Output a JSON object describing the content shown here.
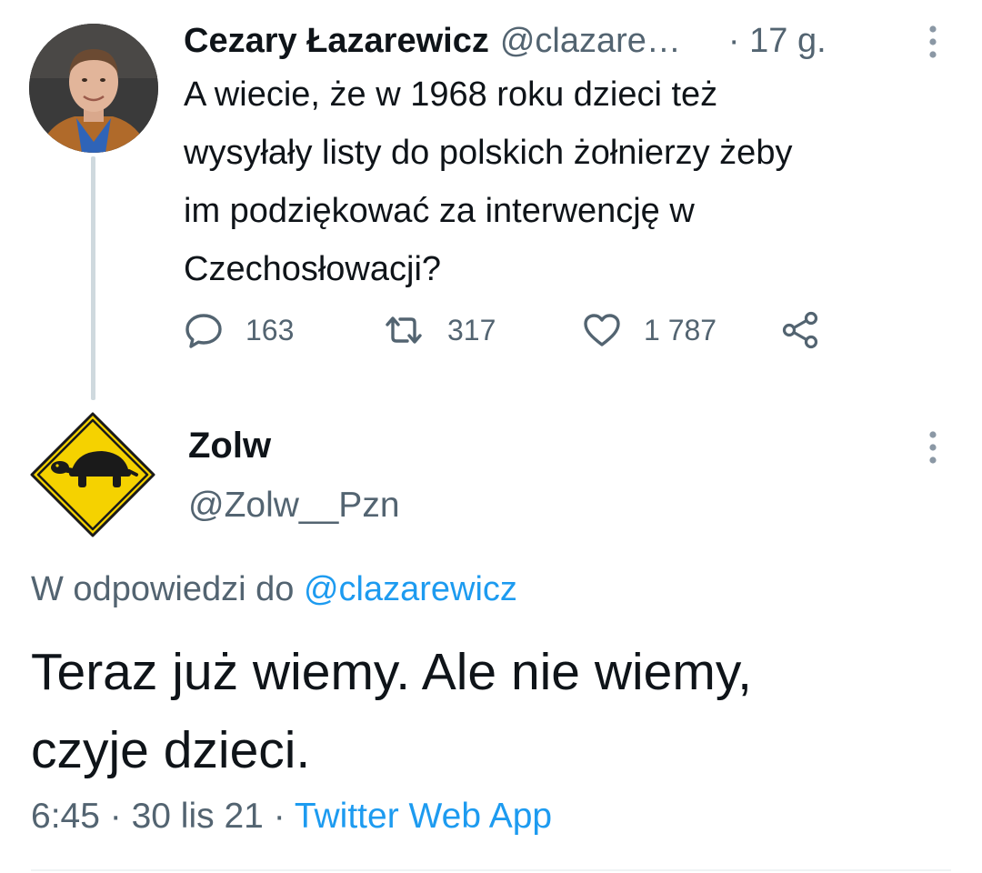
{
  "tweet1": {
    "author_name": "Cezary Łazarewicz",
    "author_handle": "@clazare…",
    "time": "· 17 g.",
    "text": "A wiecie, że w 1968 roku dzieci też\nwysyłały listy do polskich żołnierzy żeby\nim podziękować za interwencję w\nCzechosłowacji?",
    "replies": "163",
    "retweets": "317",
    "likes": "1 787",
    "icons": [
      "reply-icon",
      "retweet-icon",
      "like-icon",
      "share-icon",
      "more-options-icon"
    ]
  },
  "tweet2": {
    "author_name": "Zolw",
    "author_handle": "@Zolw__Pzn",
    "reply_prefix": "W odpowiedzi do ",
    "reply_mention": "@clazarewicz",
    "text": "Teraz już wiemy. Ale nie wiemy,\nczyje dzieci.",
    "time": "6:45",
    "date": "30 lis 21",
    "separator": "·",
    "source": "Twitter Web App",
    "icons": [
      "turtle-crossing-sign-icon",
      "more-options-icon"
    ]
  },
  "colors": {
    "text_primary": "#0f1419",
    "text_secondary": "#536471",
    "link": "#1d9bf0",
    "thread_line": "#cfd9de",
    "sign_yellow": "#f5d200"
  }
}
